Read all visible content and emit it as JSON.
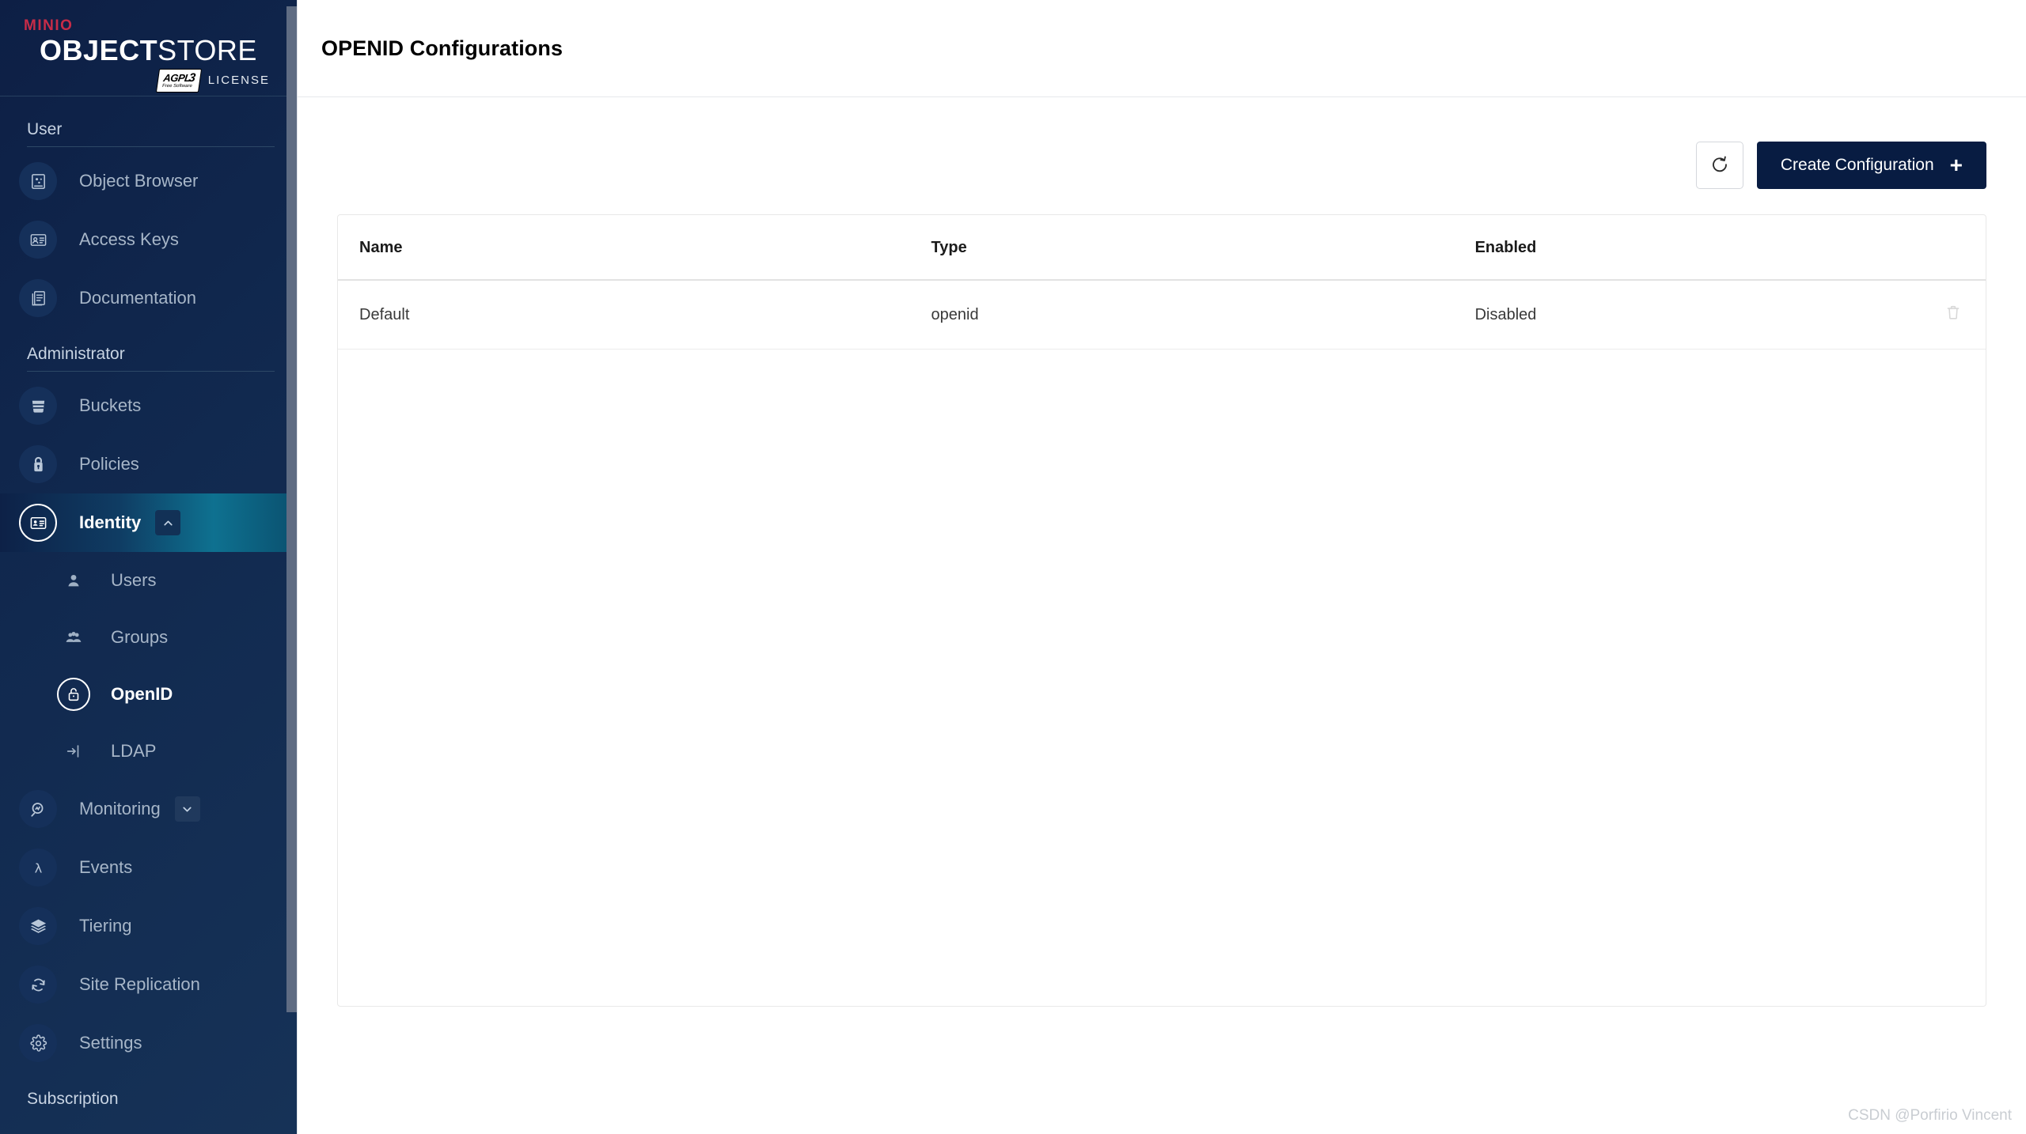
{
  "brand": {
    "minio": "MINIO",
    "product_bold": "OBJECT",
    "product_light": "STORE",
    "agpl": "AGPL",
    "agpl_sub": "Free Software",
    "agpl_version": "3",
    "license_word": "LICENSE"
  },
  "sidebar": {
    "sections": [
      {
        "title": "User",
        "items": [
          {
            "label": "Object Browser",
            "icon": "object-browser-icon",
            "active": false
          },
          {
            "label": "Access Keys",
            "icon": "access-keys-icon",
            "active": false
          },
          {
            "label": "Documentation",
            "icon": "documentation-icon",
            "active": false
          }
        ]
      },
      {
        "title": "Administrator",
        "items": [
          {
            "label": "Buckets",
            "icon": "bucket-icon",
            "active": false
          },
          {
            "label": "Policies",
            "icon": "policy-lock-icon",
            "active": false
          },
          {
            "label": "Identity",
            "icon": "identity-card-icon",
            "active": true,
            "expanded": true,
            "chevron": "chevron-up-icon",
            "children": [
              {
                "label": "Users",
                "icon": "user-icon",
                "active": false
              },
              {
                "label": "Groups",
                "icon": "groups-icon",
                "active": false
              },
              {
                "label": "OpenID",
                "icon": "openid-lock-icon",
                "active": true
              },
              {
                "label": "LDAP",
                "icon": "ldap-login-icon",
                "active": false
              }
            ]
          },
          {
            "label": "Monitoring",
            "icon": "monitoring-search-icon",
            "active": false,
            "expanded": false,
            "chevron": "chevron-down-icon"
          },
          {
            "label": "Events",
            "icon": "events-lambda-icon",
            "active": false
          },
          {
            "label": "Tiering",
            "icon": "tiering-layers-icon",
            "active": false
          },
          {
            "label": "Site Replication",
            "icon": "site-replication-icon",
            "active": false
          },
          {
            "label": "Settings",
            "icon": "gear-icon",
            "active": false
          }
        ]
      },
      {
        "title": "Subscription",
        "items": []
      }
    ]
  },
  "header": {
    "title": "OPENID Configurations"
  },
  "toolbar": {
    "refresh_icon": "refresh-icon",
    "create_label": "Create Configuration",
    "create_plus": "+"
  },
  "table": {
    "columns": [
      "Name",
      "Type",
      "Enabled",
      ""
    ],
    "rows": [
      {
        "name": "Default",
        "type": "openid",
        "enabled": "Disabled",
        "delete_icon": "trash-icon"
      }
    ]
  },
  "watermark": {
    "text": "CSDN @Porfirio Vincent"
  },
  "colors": {
    "sidebar_bg": "#0d1f45",
    "accent_active": "#0e7190",
    "brand_red": "#c72c48",
    "button_primary": "#081c42"
  }
}
